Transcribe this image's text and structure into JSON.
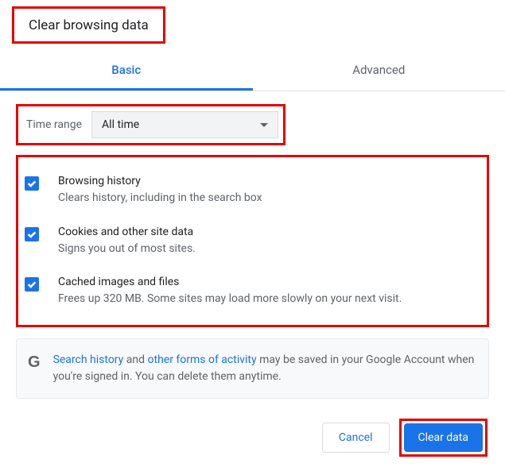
{
  "title": "Clear browsing data",
  "tabs": {
    "basic": "Basic",
    "advanced": "Advanced"
  },
  "timeRange": {
    "label": "Time range",
    "value": "All time"
  },
  "options": [
    {
      "title": "Browsing history",
      "desc": "Clears history, including in the search box",
      "checked": true
    },
    {
      "title": "Cookies and other site data",
      "desc": "Signs you out of most sites.",
      "checked": true
    },
    {
      "title": "Cached images and files",
      "desc": "Frees up 320 MB. Some sites may load more slowly on your next visit.",
      "checked": true
    }
  ],
  "info": {
    "link1": "Search history",
    "mid1": " and ",
    "link2": "other forms of activity",
    "rest": " may be saved in your Google Account when you're signed in. You can delete them anytime."
  },
  "buttons": {
    "cancel": "Cancel",
    "clear": "Clear data"
  }
}
